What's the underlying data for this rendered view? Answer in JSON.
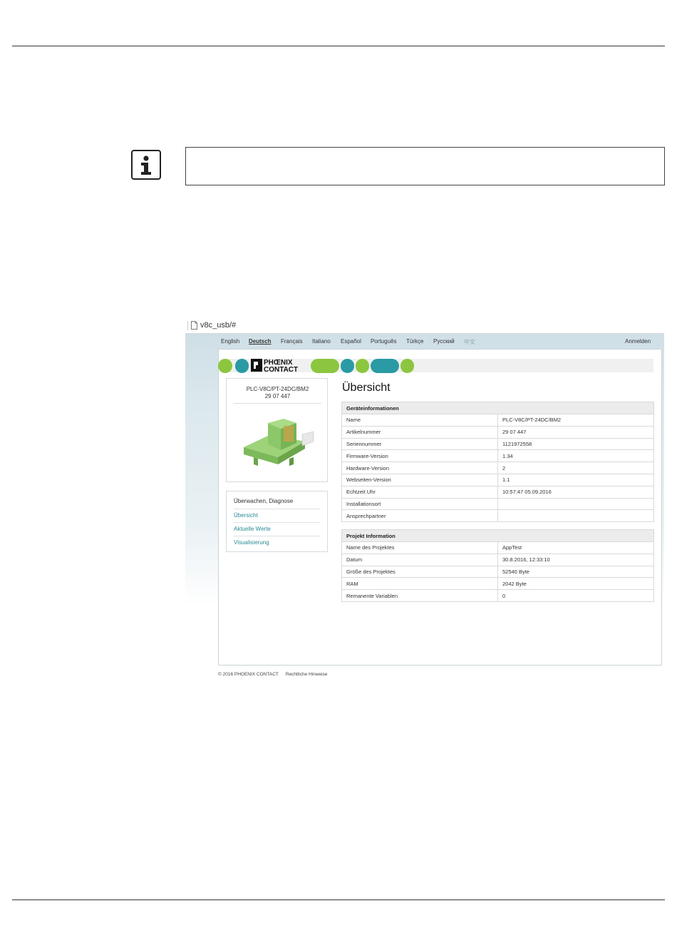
{
  "browser": {
    "url": "v8c_usb/#"
  },
  "languages": [
    "English",
    "Deutsch",
    "Français",
    "Italiano",
    "Español",
    "Português",
    "Türkçe",
    "Русский",
    "中文"
  ],
  "active_language": "Deutsch",
  "login_label": "Anmelden",
  "logo": {
    "line1": "PHŒNIX",
    "line2": "CONTACT"
  },
  "colors": {
    "green": "#8cc63f",
    "teal": "#2a9aa5"
  },
  "product": {
    "name": "PLC-V8C/PT-24DC/BM2",
    "article": "29 07 447"
  },
  "nav": {
    "heading": "Überwachen, Diagnose",
    "items": [
      "Übersicht",
      "Aktuelle Werte",
      "Visualisierung"
    ]
  },
  "page_title": "Übersicht",
  "device_info": {
    "heading": "Geräteinformationen",
    "rows": [
      [
        "Name",
        "PLC-V8C/PT-24DC/BM2"
      ],
      [
        "Artikelnummer",
        "29 07 447"
      ],
      [
        "Seriennummer",
        "1121972558"
      ],
      [
        "Firmware-Version",
        "1.34"
      ],
      [
        "Hardware-Version",
        "2"
      ],
      [
        "Webseiten-Version",
        "1.1"
      ],
      [
        "Echtzeit Uhr",
        "10:57:47 05.09.2016"
      ],
      [
        "Installationsort",
        ""
      ],
      [
        "Ansprechpartner",
        ""
      ]
    ]
  },
  "project_info": {
    "heading": "Projekt Information",
    "rows": [
      [
        "Name des Projektes",
        "AppTest"
      ],
      [
        "Datum",
        "30.8.2016, 12:33:10"
      ],
      [
        "Größe des Projektes",
        "52540 Byte"
      ],
      [
        "RAM",
        "2042 Byte"
      ],
      [
        "Remanente Variablen",
        "0"
      ]
    ]
  },
  "footer": {
    "copyright": "© 2016 PHOENIX CONTACT",
    "legal": "Rechtliche Hinweise"
  }
}
